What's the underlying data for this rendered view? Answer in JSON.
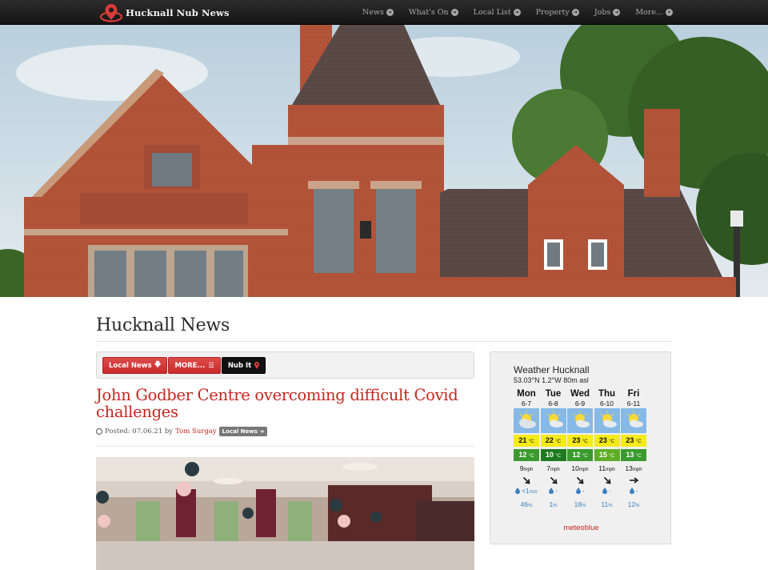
{
  "site": {
    "name": "Hucknall Nub News"
  },
  "nav": [
    {
      "label": "News"
    },
    {
      "label": "What's On"
    },
    {
      "label": "Local List"
    },
    {
      "label": "Property"
    },
    {
      "label": "Jobs"
    },
    {
      "label": "More..."
    }
  ],
  "hero": {
    "icon": "town-hall-photo"
  },
  "page": {
    "title": "Hucknall News"
  },
  "toolbar": {
    "local_news": "Local News",
    "more": "MORE...",
    "nub_it": "Nub It"
  },
  "article": {
    "title": "John Godber Centre overcoming difficult Covid challenges",
    "posted_prefix": "Posted: 07.06.21 by",
    "author": "Tom Surgay",
    "category": "Local News",
    "image_icon": "event-hall-photo"
  },
  "weather": {
    "title": "Weather Hucknall",
    "coords": "53.03°N 1.2°W 80m asl",
    "temp_unit": "°C",
    "wind_unit": "mph",
    "prob_unit": "%",
    "days": [
      {
        "day": "Mon",
        "date": "6-7",
        "max": "21",
        "min": "12",
        "wind": "9",
        "rain": "<1",
        "rain_unit": "mm",
        "prob": "46",
        "min_color": "#3a9a2e"
      },
      {
        "day": "Tue",
        "date": "6-8",
        "max": "22",
        "min": "10",
        "wind": "7",
        "rain": "-",
        "rain_unit": "",
        "prob": "1",
        "min_color": "#1f7a1f"
      },
      {
        "day": "Wed",
        "date": "6-9",
        "max": "23",
        "min": "12",
        "wind": "10",
        "rain": "-",
        "rain_unit": "",
        "prob": "18",
        "min_color": "#3a9a2e"
      },
      {
        "day": "Thu",
        "date": "6-10",
        "max": "23",
        "min": "15",
        "wind": "11",
        "rain": "-",
        "rain_unit": "",
        "prob": "11",
        "min_color": "#5fae2a"
      },
      {
        "day": "Fri",
        "date": "6-11",
        "max": "23",
        "min": "13",
        "wind": "13",
        "rain": "-",
        "rain_unit": "",
        "prob": "12",
        "min_color": "#3a9a2e"
      }
    ],
    "brand": "meteoblue"
  },
  "colors": {
    "accent": "#c5261f",
    "nav_bg": "#1d1d1d",
    "sun": "#f5ea1a",
    "sky": "#86b9e6"
  }
}
